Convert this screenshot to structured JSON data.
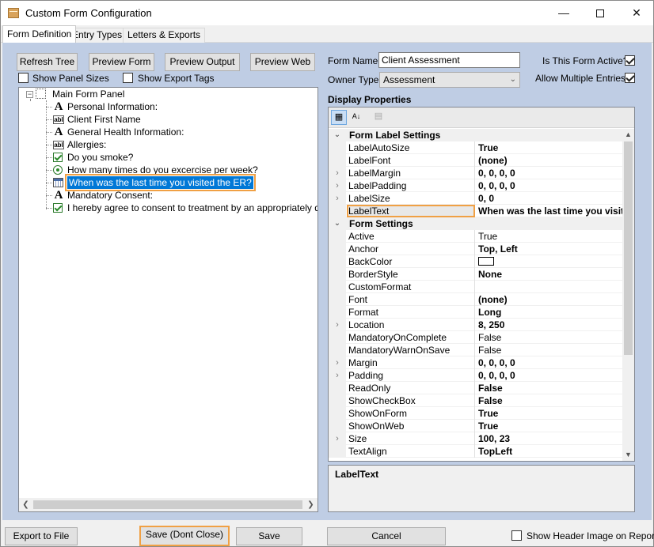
{
  "window": {
    "title": "Custom Form Configuration",
    "minimize_glyph": "—",
    "close_glyph": "✕",
    "icon": "app-box-icon"
  },
  "tabs": [
    {
      "label": "Form Definition",
      "active": true
    },
    {
      "label": "Entry Types",
      "active": false
    },
    {
      "label": "Letters & Exports",
      "active": false
    }
  ],
  "toolbar": {
    "refresh_tree": "Refresh Tree",
    "preview_form": "Preview Form",
    "preview_output": "Preview Output",
    "preview_web": "Preview Web",
    "show_panel_sizes": "Show Panel Sizes",
    "show_export_tags": "Show Export Tags"
  },
  "tree": {
    "root": {
      "label": "Main Form Panel",
      "icon": "panel-icon"
    },
    "items": [
      {
        "label": "Personal Information:",
        "icon": "label-icon"
      },
      {
        "label": "Client First Name",
        "icon": "textbox-icon"
      },
      {
        "label": "General Health Information:",
        "icon": "label-icon"
      },
      {
        "label": "Allergies:",
        "icon": "textbox-icon"
      },
      {
        "label": "Do you smoke?",
        "icon": "checkbox-icon"
      },
      {
        "label": "How many times do you excercise per week?",
        "icon": "radio-icon"
      },
      {
        "label": "When was the last time you visited the ER?",
        "icon": "calendar-icon",
        "selected": true
      },
      {
        "label": "Mandatory Consent:",
        "icon": "label-icon"
      },
      {
        "label": "I hereby agree to consent to treatment by an appropriately qualified",
        "icon": "checkbox-icon"
      }
    ],
    "scroll_left": "❮",
    "scroll_right": "❯"
  },
  "form": {
    "name_label": "Form Name",
    "name_value": "Client Assessment",
    "owner_label": "Owner Type",
    "owner_value": "Assessment",
    "active_label": "Is This Form Active?",
    "active_checked": true,
    "multiple_label": "Allow Multiple Entries?",
    "multiple_checked": true
  },
  "display_properties": {
    "title": "Display Properties",
    "categories": [
      {
        "name": "Form Label Settings",
        "rows": [
          {
            "name": "LabelAutoSize",
            "value": "True",
            "bold": true,
            "expandable": false
          },
          {
            "name": "LabelFont",
            "value": "(none)",
            "bold": true,
            "expandable": false
          },
          {
            "name": "LabelMargin",
            "value": "0, 0, 0, 0",
            "bold": true,
            "expandable": true
          },
          {
            "name": "LabelPadding",
            "value": "0, 0, 0, 0",
            "bold": true,
            "expandable": true
          },
          {
            "name": "LabelSize",
            "value": "0, 0",
            "bold": true,
            "expandable": true
          },
          {
            "name": "LabelText",
            "value": "When was the last time you visit",
            "bold": true,
            "expandable": false,
            "selected": true
          }
        ]
      },
      {
        "name": "Form Settings",
        "rows": [
          {
            "name": "Active",
            "value": "True",
            "bold": false,
            "expandable": false
          },
          {
            "name": "Anchor",
            "value": "Top, Left",
            "bold": true,
            "expandable": false
          },
          {
            "name": "BackColor",
            "value": "",
            "bold": false,
            "expandable": false,
            "swatch": "#ffffff"
          },
          {
            "name": "BorderStyle",
            "value": "None",
            "bold": true,
            "expandable": false
          },
          {
            "name": "CustomFormat",
            "value": "",
            "bold": false,
            "expandable": false
          },
          {
            "name": "Font",
            "value": "(none)",
            "bold": true,
            "expandable": false
          },
          {
            "name": "Format",
            "value": "Long",
            "bold": true,
            "expandable": false
          },
          {
            "name": "Location",
            "value": "8, 250",
            "bold": true,
            "expandable": true
          },
          {
            "name": "MandatoryOnComplete",
            "value": "False",
            "bold": false,
            "expandable": false
          },
          {
            "name": "MandatoryWarnOnSave",
            "value": "False",
            "bold": false,
            "expandable": false
          },
          {
            "name": "Margin",
            "value": "0, 0, 0, 0",
            "bold": true,
            "expandable": true
          },
          {
            "name": "Padding",
            "value": "0, 0, 0, 0",
            "bold": true,
            "expandable": true
          },
          {
            "name": "ReadOnly",
            "value": "False",
            "bold": true,
            "expandable": false
          },
          {
            "name": "ShowCheckBox",
            "value": "False",
            "bold": true,
            "expandable": false
          },
          {
            "name": "ShowOnForm",
            "value": "True",
            "bold": true,
            "expandable": false
          },
          {
            "name": "ShowOnWeb",
            "value": "True",
            "bold": true,
            "expandable": false
          },
          {
            "name": "Size",
            "value": "100, 23",
            "bold": true,
            "expandable": true
          },
          {
            "name": "TextAlign",
            "value": "TopLeft",
            "bold": true,
            "expandable": false
          }
        ]
      }
    ],
    "description_title": "LabelText"
  },
  "footer": {
    "export_to_file": "Export to File",
    "save_dont_close": "Save (Dont Close)",
    "save": "Save",
    "cancel": "Cancel",
    "show_header_image": "Show Header Image on Report?",
    "show_header_image_checked": false
  },
  "colors": {
    "panel_bg": "#bfcde4",
    "selection": "#0078d7",
    "highlight_outline": "#f0a044"
  }
}
